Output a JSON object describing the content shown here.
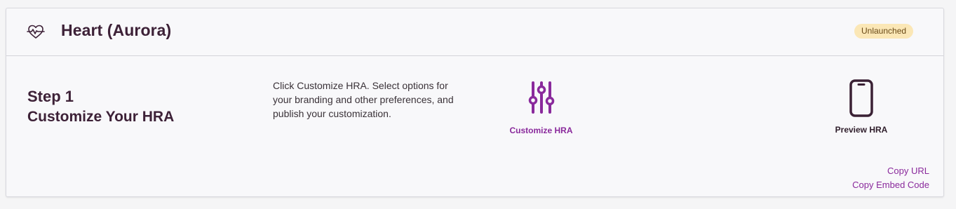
{
  "card": {
    "title": "Heart (Aurora)",
    "status": "Unlaunched",
    "icon": "heart-rate-icon"
  },
  "step": {
    "number": "Step 1",
    "title": "Customize Your HRA",
    "description": "Click Customize HRA. Select options for your branding and other preferences, and publish your customization."
  },
  "actions": {
    "customize_label": "Customize HRA",
    "customize_icon": "sliders-icon",
    "preview_label": "Preview HRA",
    "preview_icon": "mobile-phone-icon"
  },
  "links": {
    "copy_url": "Copy URL",
    "copy_embed": "Copy Embed Code"
  },
  "colors": {
    "accent": "#8a2a9c",
    "title": "#3d2137",
    "badge_bg": "#fbe7b6"
  }
}
